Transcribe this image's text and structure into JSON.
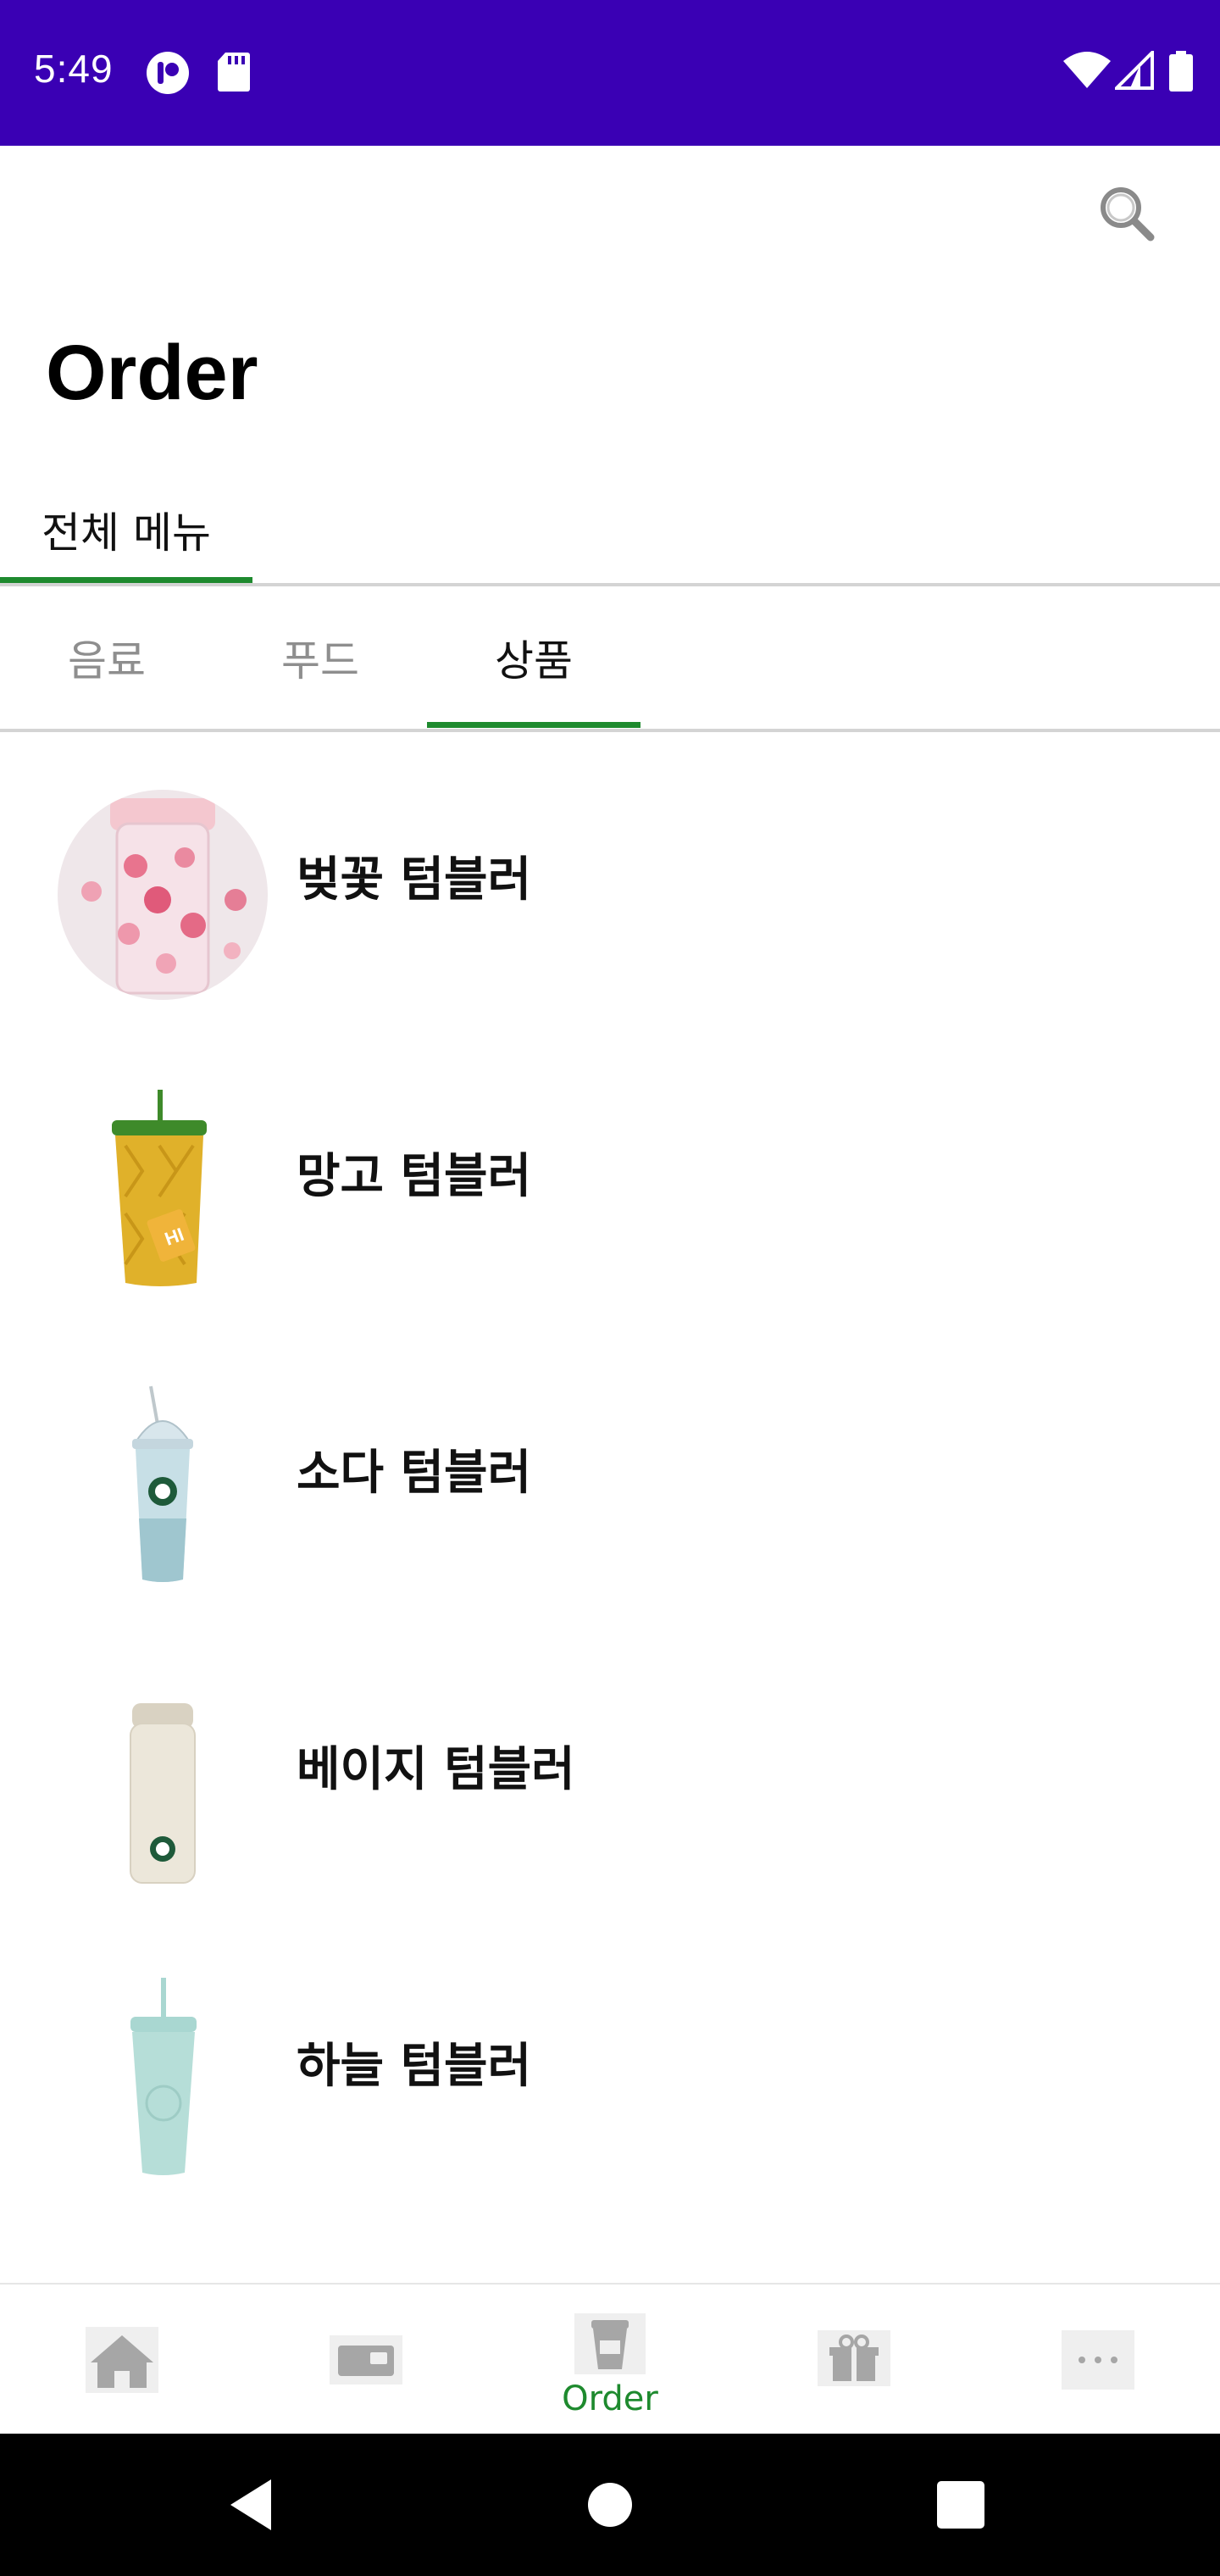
{
  "status_bar": {
    "time": "5:49",
    "background": "#3A00B4",
    "icons": [
      "app-notification-icon",
      "sd-card-icon",
      "wifi-icon",
      "cell-signal-icon",
      "battery-icon"
    ]
  },
  "header": {
    "search_icon": "search-icon",
    "title": "Order"
  },
  "top_tabs": [
    {
      "label": "전체 메뉴",
      "active": true
    }
  ],
  "sub_tabs": [
    {
      "label": "음료",
      "active": false
    },
    {
      "label": "푸드",
      "active": false
    },
    {
      "label": "상품",
      "active": true
    }
  ],
  "products": [
    {
      "name": "벚꽃 텀블러",
      "image": "cherry-blossom-tumbler"
    },
    {
      "name": "망고 텀블러",
      "image": "mango-tumbler"
    },
    {
      "name": "소다 텀블러",
      "image": "soda-tumbler"
    },
    {
      "name": "베이지 텀블러",
      "image": "beige-tumbler"
    },
    {
      "name": "하늘 텀블러",
      "image": "sky-tumbler"
    }
  ],
  "bottom_nav": {
    "items": [
      {
        "icon": "home-icon",
        "label": ""
      },
      {
        "icon": "pay-card-icon",
        "label": ""
      },
      {
        "icon": "order-cup-icon",
        "label": "Order",
        "active": true
      },
      {
        "icon": "gift-icon",
        "label": ""
      },
      {
        "icon": "more-icon",
        "label": ""
      }
    ]
  },
  "colors": {
    "accent": "#1E8A2E",
    "inactive_tab": "#8E8E8E",
    "nav_icon_gray": "#A6A6A6"
  }
}
